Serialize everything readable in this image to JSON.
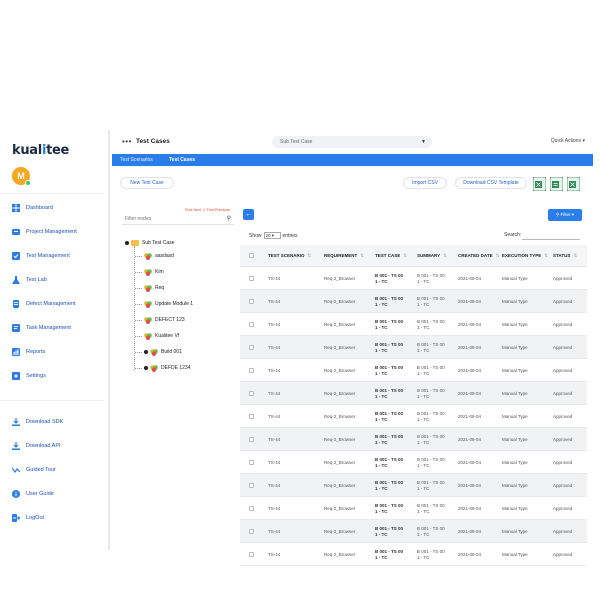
{
  "brand": {
    "logo_pre": "kual",
    "logo_i": "i",
    "logo_post": "tee",
    "accent": "#2b7de9"
  },
  "user": {
    "avatar_letter": "M"
  },
  "sidebar": {
    "items": [
      {
        "label": "Dashboard",
        "icon": "dashboard-icon"
      },
      {
        "label": "Project Management",
        "icon": "project-icon"
      },
      {
        "label": "Test Management",
        "icon": "test-management-icon"
      },
      {
        "label": "Test Lab",
        "icon": "flask-icon"
      },
      {
        "label": "Defect Management",
        "icon": "defect-icon"
      },
      {
        "label": "Task Management",
        "icon": "task-icon"
      },
      {
        "label": "Reports",
        "icon": "reports-icon"
      },
      {
        "label": "Settings",
        "icon": "settings-icon"
      }
    ],
    "bottom_items": [
      {
        "label": "Download SDK",
        "icon": "download-icon"
      },
      {
        "label": "Download API",
        "icon": "download-api-icon"
      },
      {
        "label": "Guided Tour",
        "icon": "tour-icon"
      },
      {
        "label": "User Guide",
        "icon": "info-icon"
      },
      {
        "label": "LogOut",
        "icon": "logout-icon"
      }
    ]
  },
  "header": {
    "dots": "•••",
    "title": "Test Cases",
    "select_value": "Sub Test Case",
    "quick_actions": "Quick Actions ▾"
  },
  "tabs": [
    {
      "label": "Test Scenarios"
    },
    {
      "label": "Test Cases"
    }
  ],
  "actions": {
    "new_test_case": "New Test Case",
    "import_csv": "Import CSV",
    "download_csv_template": "Download CSV Template"
  },
  "tree": {
    "find": "Find Next  ⇩ Find Previous",
    "filter_placeholder": "Filter nodes",
    "root": "Sub Test Case",
    "nodes": [
      {
        "label": "aasdasd",
        "kind": "leaf"
      },
      {
        "label": "Kim",
        "kind": "leaf"
      },
      {
        "label": "Req",
        "kind": "leaf"
      },
      {
        "label": "Update Module 1",
        "kind": "leaf"
      },
      {
        "label": "DEFECT 123",
        "kind": "leaf"
      },
      {
        "label": "Kualitee Vf",
        "kind": "leaf"
      },
      {
        "label": "Build 001",
        "kind": "group"
      },
      {
        "label": "DEFDE 1234",
        "kind": "group"
      }
    ]
  },
  "table_controls": {
    "back": "←",
    "filter": "⚲ Filter ▾",
    "show": "Show",
    "entries_value": "20 ▾",
    "entries": "entries",
    "search": "Search:"
  },
  "table": {
    "columns": [
      "TEST SCENARIO",
      "REQUIREMENT",
      "TEST CASE",
      "SUMMARY",
      "CREATED DATE",
      "EXECUTION TYPE",
      "STATUS"
    ],
    "rows": [
      {
        "scenario": "TS-44",
        "requirement": "Req-2_Browser",
        "test_case_1": "B 001 - TS 00",
        "test_case_2": "1 - TC",
        "summary_1": "B 001 - TS 00",
        "summary_2": "1 - TC",
        "date": "2021-08-04",
        "exec": "Manual Type",
        "status": "Approved"
      },
      {
        "scenario": "TS-44",
        "requirement": "Req-2_Browser",
        "test_case_1": "B 001 - TS 00",
        "test_case_2": "1 - TC",
        "summary_1": "B 001 - TS 00",
        "summary_2": "1 - TC",
        "date": "2021-08-04",
        "exec": "Manual Type",
        "status": "Approved"
      },
      {
        "scenario": "TS-44",
        "requirement": "Req-2_Browser",
        "test_case_1": "B 001 - TS 00",
        "test_case_2": "1 - TC",
        "summary_1": "B 001 - TS 00",
        "summary_2": "1 - TC",
        "date": "2021-08-04",
        "exec": "Manual Type",
        "status": "Approved"
      },
      {
        "scenario": "TS-44",
        "requirement": "Req-2_Browser",
        "test_case_1": "B 001 - TS 00",
        "test_case_2": "1 - TC",
        "summary_1": "B 001 - TS 00",
        "summary_2": "1 - TC",
        "date": "2021-08-04",
        "exec": "Manual Type",
        "status": "Approved"
      },
      {
        "scenario": "TS-44",
        "requirement": "Req-2_Browser",
        "test_case_1": "B 001 - TS 00",
        "test_case_2": "1 - TC",
        "summary_1": "B 001 - TS 00",
        "summary_2": "1 - TC",
        "date": "2021-08-04",
        "exec": "Manual Type",
        "status": "Approved"
      },
      {
        "scenario": "TS-44",
        "requirement": "Req-2_Browser",
        "test_case_1": "B 001 - TS 00",
        "test_case_2": "1 - TC",
        "summary_1": "B 001 - TS 00",
        "summary_2": "1 - TC",
        "date": "2021-08-04",
        "exec": "Manual Type",
        "status": "Approved"
      },
      {
        "scenario": "TS-44",
        "requirement": "Req-2_Browser",
        "test_case_1": "B 001 - TS 00",
        "test_case_2": "1 - TC",
        "summary_1": "B 001 - TS 00",
        "summary_2": "1 - TC",
        "date": "2021-08-04",
        "exec": "Manual Type",
        "status": "Approved"
      },
      {
        "scenario": "TS-44",
        "requirement": "Req-2_Browser",
        "test_case_1": "B 001 - TS 00",
        "test_case_2": "1 - TC",
        "summary_1": "B 001 - TS 00",
        "summary_2": "1 - TC",
        "date": "2021-08-04",
        "exec": "Manual Type",
        "status": "Approved"
      },
      {
        "scenario": "TS-44",
        "requirement": "Req-2_Browser",
        "test_case_1": "B 001 - TS 00",
        "test_case_2": "1 - TC",
        "summary_1": "B 001 - TS 00",
        "summary_2": "1 - TC",
        "date": "2021-08-04",
        "exec": "Manual Type",
        "status": "Approved"
      },
      {
        "scenario": "TS-44",
        "requirement": "Req-2_Browser",
        "test_case_1": "B 001 - TS 00",
        "test_case_2": "1 - TC",
        "summary_1": "B 001 - TS 00",
        "summary_2": "1 - TC",
        "date": "2021-08-04",
        "exec": "Manual Type",
        "status": "Approved"
      },
      {
        "scenario": "TS-44",
        "requirement": "Req-2_Browser",
        "test_case_1": "B 001 - TS 00",
        "test_case_2": "1 - TC",
        "summary_1": "B 001 - TS 00",
        "summary_2": "1 - TC",
        "date": "2021-08-04",
        "exec": "Manual Type",
        "status": "Approved"
      },
      {
        "scenario": "TS-44",
        "requirement": "Req-2_Browser",
        "test_case_1": "B 001 - TS 00",
        "test_case_2": "1 - TC",
        "summary_1": "B 001 - TS 00",
        "summary_2": "1 - TC",
        "date": "2021-08-04",
        "exec": "Manual Type",
        "status": "Approved"
      },
      {
        "scenario": "TS-44",
        "requirement": "Req-2_Browser",
        "test_case_1": "B 001 - TS 00",
        "test_case_2": "1 - TC",
        "summary_1": "B 001 - TS 00",
        "summary_2": "1 - TC",
        "date": "2021-08-04",
        "exec": "Manual Type",
        "status": "Approved"
      }
    ]
  }
}
